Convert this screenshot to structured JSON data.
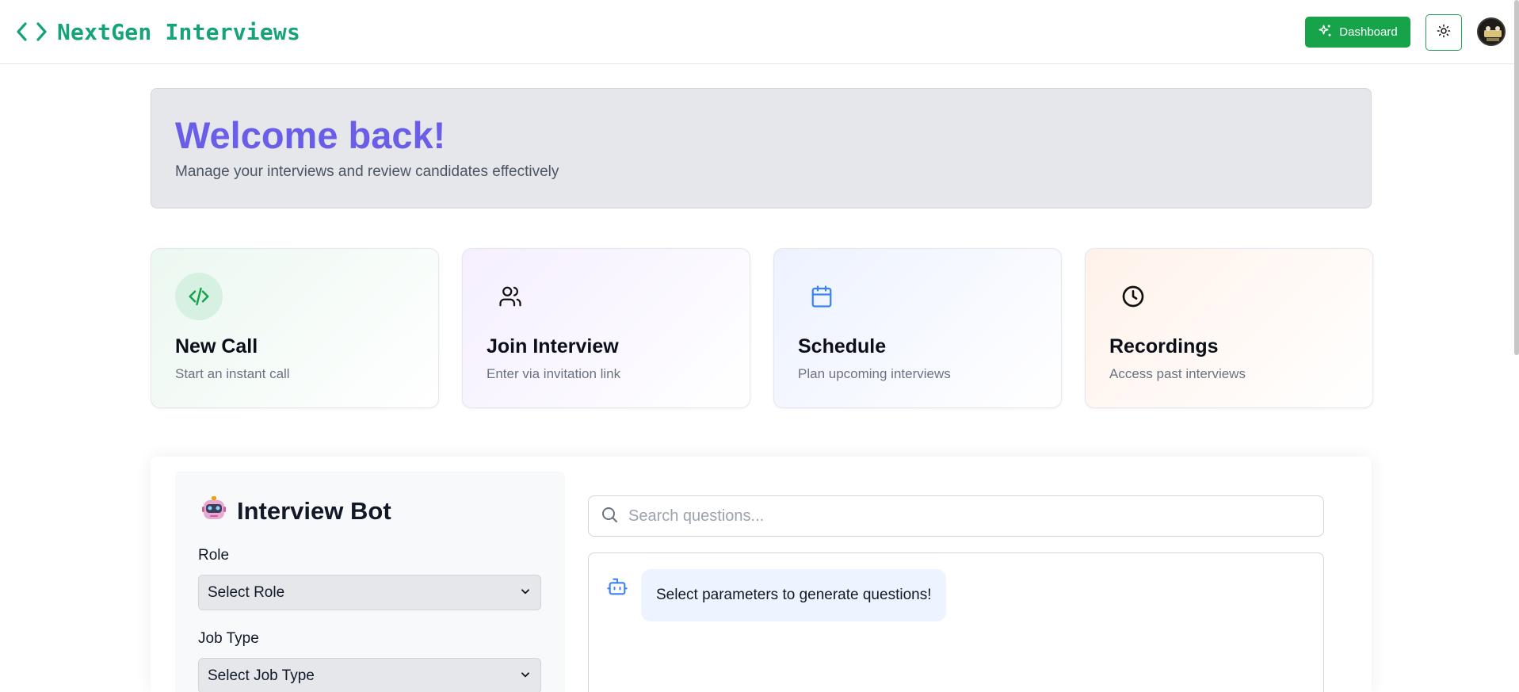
{
  "header": {
    "brand_name": "NextGen Interviews",
    "dashboard_label": "Dashboard",
    "accent_color": "#16a34a"
  },
  "welcome": {
    "title": "Welcome back!",
    "subtitle": "Manage your interviews and review candidates effectively"
  },
  "cards": [
    {
      "title": "New Call",
      "subtitle": "Start an instant call",
      "icon": "code-icon"
    },
    {
      "title": "Join Interview",
      "subtitle": "Enter via invitation link",
      "icon": "users-icon"
    },
    {
      "title": "Schedule",
      "subtitle": "Plan upcoming interviews",
      "icon": "calendar-icon"
    },
    {
      "title": "Recordings",
      "subtitle": "Access past interviews",
      "icon": "clock-icon"
    }
  ],
  "bot": {
    "title": "Interview Bot",
    "role_label": "Role",
    "role_value": "Select Role",
    "job_type_label": "Job Type",
    "job_type_value": "Select Job Type",
    "search_placeholder": "Search questions...",
    "message": "Select parameters to generate questions!"
  }
}
